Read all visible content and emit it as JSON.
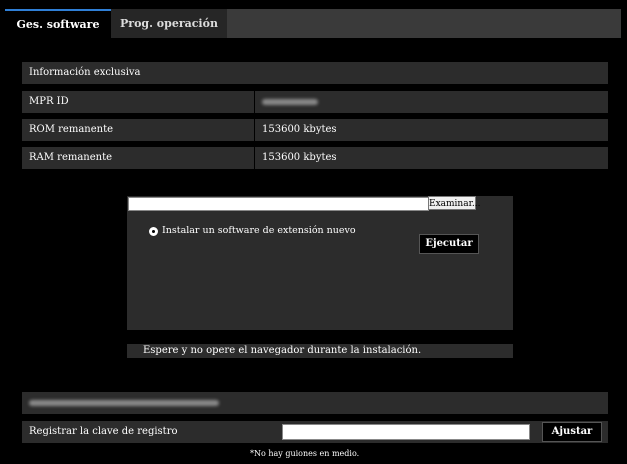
{
  "tabs": [
    {
      "label": "Ges. software",
      "active": true
    },
    {
      "label": "Prog. operación",
      "active": false
    }
  ],
  "info": {
    "header": "Información exclusiva",
    "rows": [
      {
        "label": "MPR ID",
        "value": ""
      },
      {
        "label": "ROM remanente",
        "value": "153600 kbytes"
      },
      {
        "label": "RAM remanente",
        "value": "153600 kbytes"
      }
    ]
  },
  "install": {
    "browse_label": "Examinar...",
    "option_label": "Instalar un software de extensión nuevo",
    "execute_label": "Ejecutar",
    "wait_message": "Espere y no opere el navegador durante la instalación."
  },
  "registration": {
    "row_label": "Registrar la clave de registro",
    "set_label": "Ajustar",
    "note": "*No hay guiones en medio."
  },
  "colors": {
    "accent": "#2f7fd6",
    "panel": "#2c2c2c",
    "background": "#000000"
  }
}
